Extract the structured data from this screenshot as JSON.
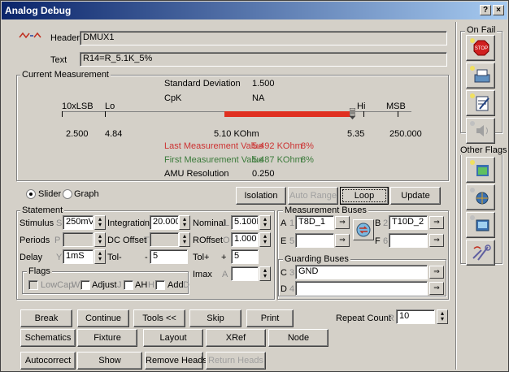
{
  "window": {
    "title": "Analog Debug",
    "help_label": "?",
    "close_label": "×"
  },
  "header": {
    "label": "Header",
    "value": "DMUX1"
  },
  "text": {
    "label": "Text",
    "value": "R14=R_5.1K_5%"
  },
  "measurement": {
    "group_title": "Current Measurement",
    "std_dev_label": "Standard Deviation",
    "std_dev_value": "1.500",
    "cpk_label": "CpK",
    "cpk_value": "NA",
    "scale": {
      "lo10_label": "10xLSB",
      "lo_label": "Lo",
      "hi_label": "Hi",
      "msb_label": "MSB",
      "v10lsb": "2.500",
      "vlo": "4.84",
      "vnom": "5.10 KOhm",
      "vhi": "5.35",
      "vmsb": "250.000",
      "bar_fill_fraction": 0.83
    },
    "last_label": "Last Measurement Value",
    "last_value": "5.492 KOhm",
    "last_pct": "8%",
    "first_label": "First Measurement Value",
    "first_value": "5.487 KOhm",
    "first_pct": "8%",
    "amu_label": "AMU Resolution",
    "amu_value": "0.250"
  },
  "view": {
    "slider_label": "Slider",
    "graph_label": "Graph"
  },
  "actions": {
    "isolation": "Isolation",
    "auto_range": "Auto Range",
    "loop": "Loop",
    "update": "Update"
  },
  "statement": {
    "group_title": "Statement",
    "stimulus_label": "Stimulus",
    "stimulus_key": "S",
    "stimulus_value": "250mV",
    "integration_label": "Integration",
    "integration_key": "I",
    "integration_value": "20.000",
    "nominal_label": "Nominal",
    "nominal_key": "L",
    "nominal_value": "5.100K",
    "periods_label": "Periods",
    "periods_key": "P",
    "periods_value": "",
    "dc_offset_label": "DC Offset",
    "dc_offset_key": "T",
    "dc_offset_value": "",
    "roffset_label": "ROffset",
    "roffset_key": "O",
    "roffset_value": "1.000",
    "delay_label": "Delay",
    "delay_key": "Y",
    "delay_value": "1mS",
    "tol_minus_label": "Tol-",
    "tol_minus_sign": "-",
    "tol_minus_value": "5",
    "tol_plus_label": "Tol+",
    "tol_plus_sign": "+",
    "tol_plus_value": "5",
    "imax_label": "Imax",
    "imax_key": "A",
    "imax_value": "",
    "flags_title": "Flags",
    "lowcap_label": "LowCap",
    "lowcap_key": "W",
    "adjust_label": "Adjust",
    "adjust_key": "J",
    "ah_label": "AH",
    "ah_key": "H",
    "add_label": "Add",
    "add_key": "D"
  },
  "buses": {
    "group_title": "Measurement Buses",
    "a_label": "A",
    "a_key": "1",
    "a_value": "T8D_1",
    "b_label": "B",
    "b_key": "2",
    "b_value": "T10D_2",
    "e_label": "E",
    "e_key": "5",
    "e_value": "",
    "f_label": "F",
    "f_key": "6",
    "f_value": "",
    "guard_title": "Guarding Buses",
    "c_label": "C",
    "c_key": "3",
    "c_value": "GND",
    "d_label": "D",
    "d_key": "4",
    "d_value": ""
  },
  "bottom": {
    "break": "Break",
    "continue": "Continue",
    "tools": "Tools <<",
    "skip": "Skip",
    "print": "Print",
    "repeat_label": "Repeat Count",
    "repeat_key": "R",
    "repeat_value": "10",
    "schematics": "Schematics",
    "fixture": "Fixture",
    "layout": "Layout",
    "xref": "XRef",
    "node": "Node",
    "autocorrect": "Autocorrect",
    "show": "Show",
    "remove_heads": "Remove Heads",
    "return_heads": "Return Heads"
  },
  "side": {
    "on_fail_title": "On Fail",
    "other_flags_title": "Other Flags"
  },
  "colors": {
    "title_start": "#0a246a",
    "title_end": "#a6caf0",
    "bar_red": "#e03020",
    "last_value": "#cc3333",
    "first_value": "#3a7a3a"
  }
}
